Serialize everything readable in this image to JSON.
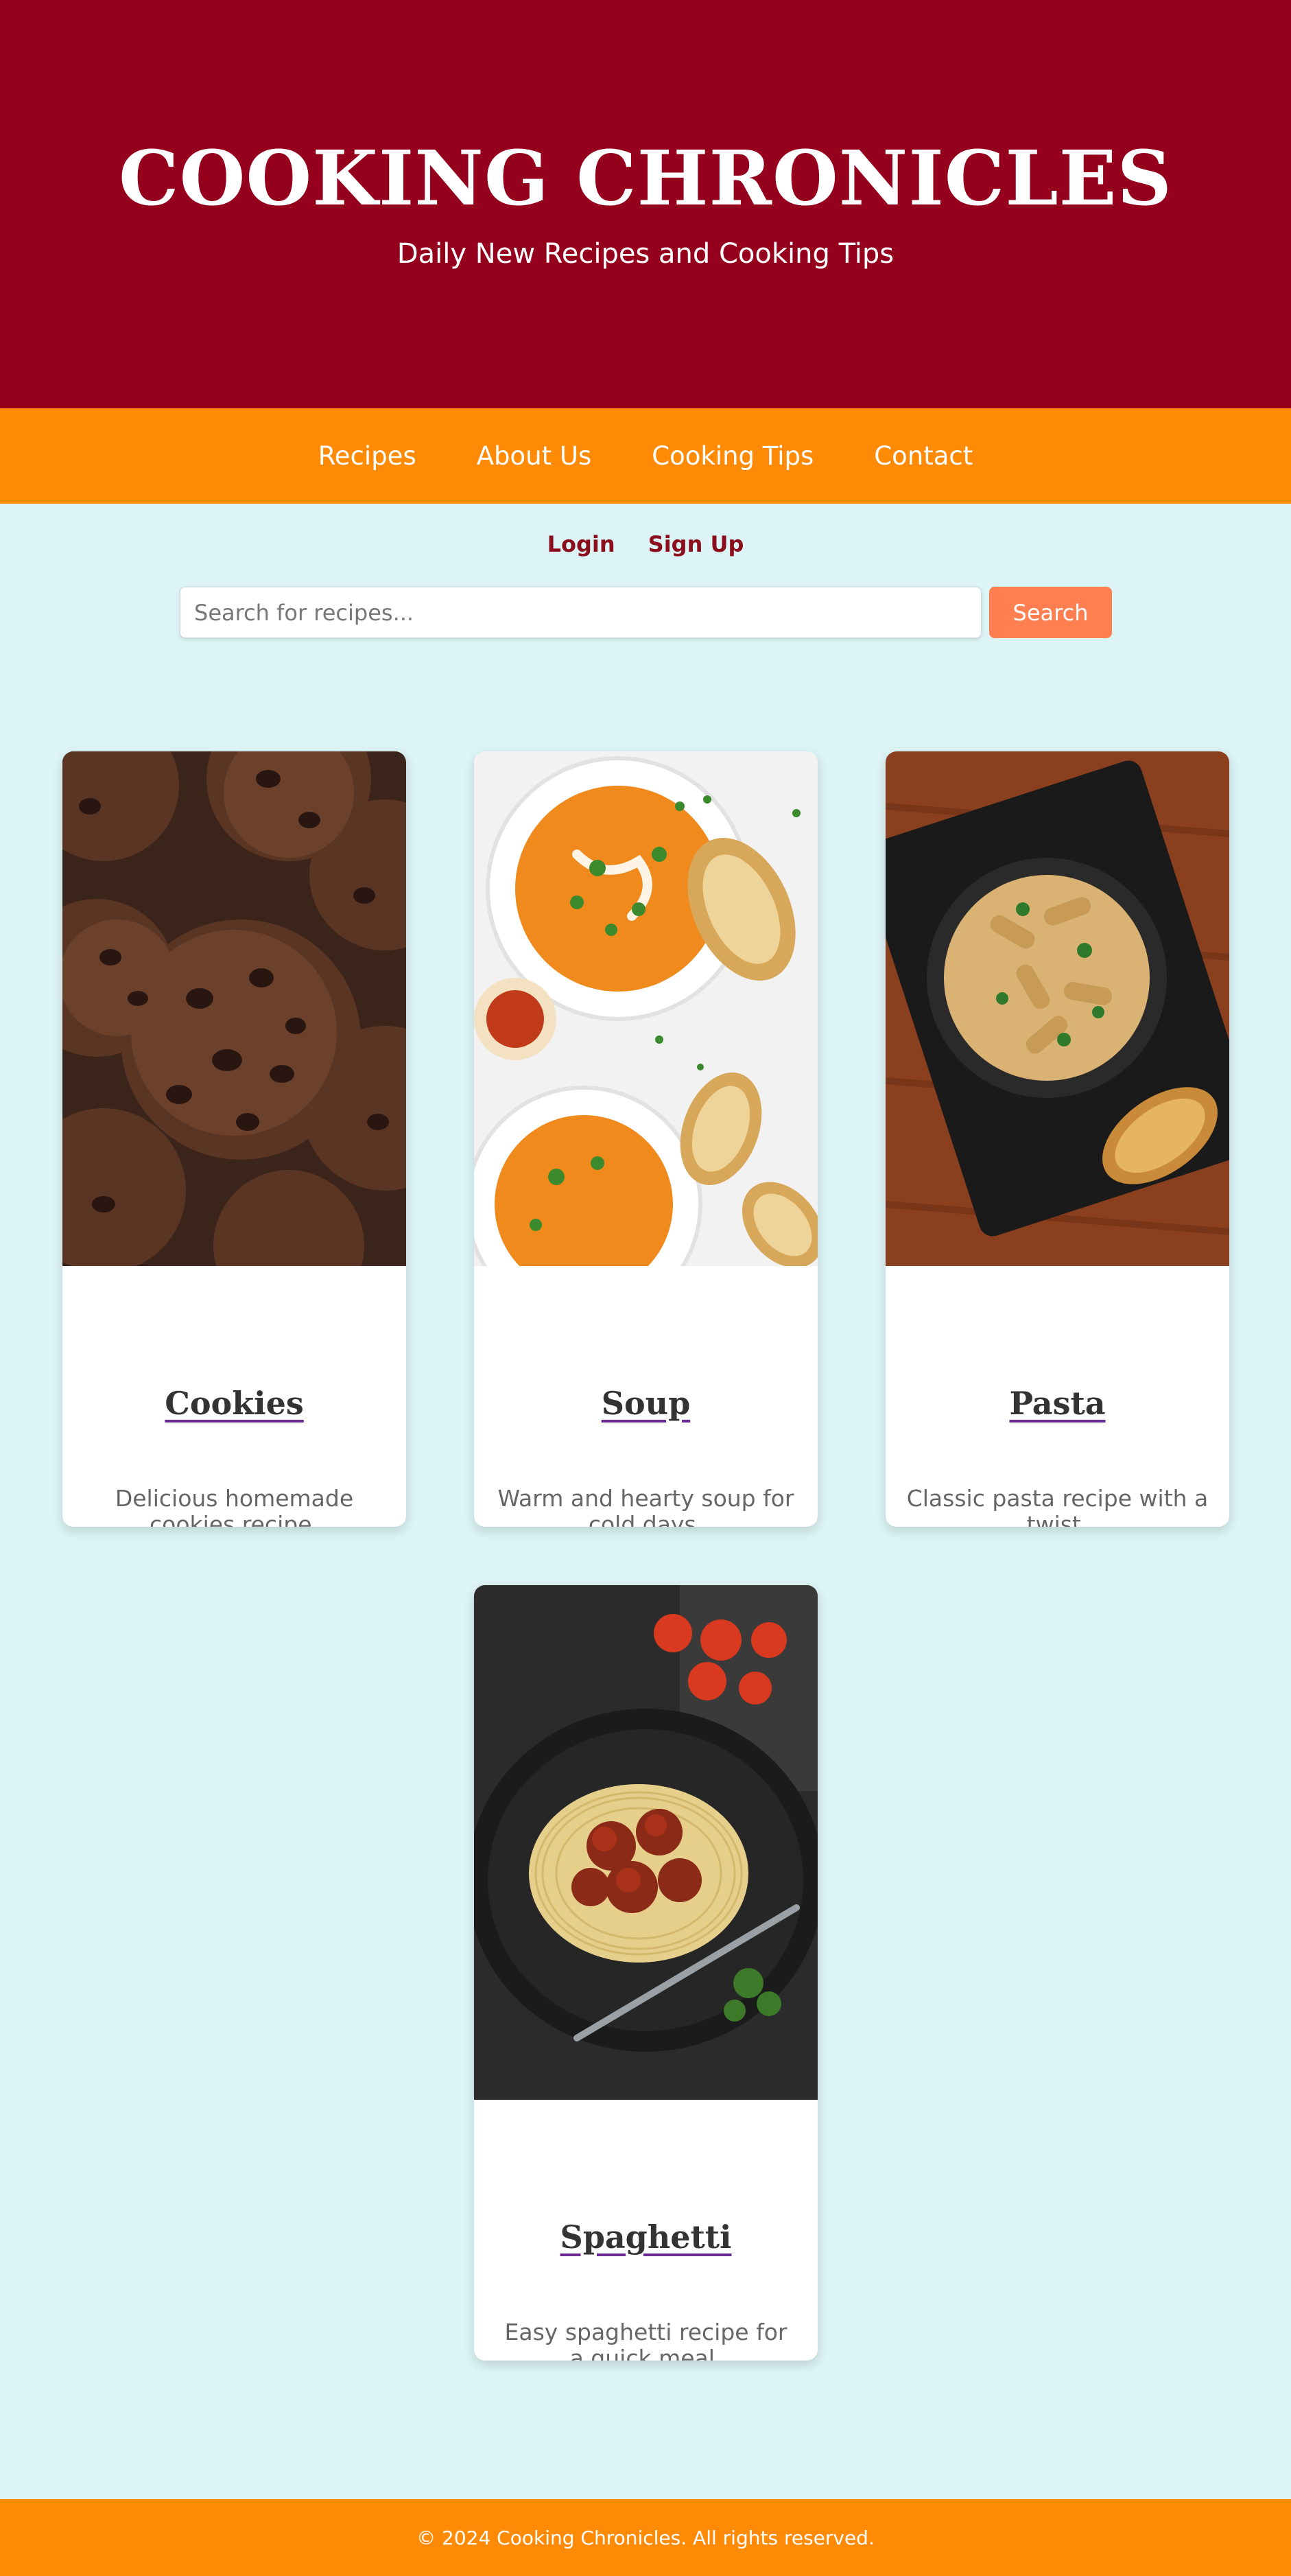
{
  "header": {
    "title": "COOKING CHRONICLES",
    "subtitle": "Daily New Recipes and Cooking Tips"
  },
  "nav": {
    "items": [
      {
        "label": "Recipes"
      },
      {
        "label": "About Us"
      },
      {
        "label": "Cooking Tips"
      },
      {
        "label": "Contact"
      }
    ]
  },
  "auth": {
    "login": "Login",
    "signup": "Sign Up"
  },
  "search": {
    "placeholder": "Search for recipes...",
    "value": "",
    "button_label": "Search"
  },
  "recipes": [
    {
      "title": "Cookies",
      "description": "Delicious homemade cookies recipe.",
      "image": "cookies-photo"
    },
    {
      "title": "Soup",
      "description": "Warm and hearty soup for cold days.",
      "image": "soup-photo"
    },
    {
      "title": "Pasta",
      "description": "Classic pasta recipe with a twist.",
      "image": "pasta-photo"
    },
    {
      "title": "Spaghetti",
      "description": "Easy spaghetti recipe for a quick meal.",
      "image": "spaghetti-photo"
    }
  ],
  "footer": {
    "text": "© 2024 Cooking Chronicles. All rights reserved."
  },
  "colors": {
    "header_bg": "#95001c",
    "nav_bg": "#ff8a05",
    "page_bg": "#dcf4f5",
    "accent": "#ff7f50",
    "auth_link": "#8c0d1c"
  }
}
